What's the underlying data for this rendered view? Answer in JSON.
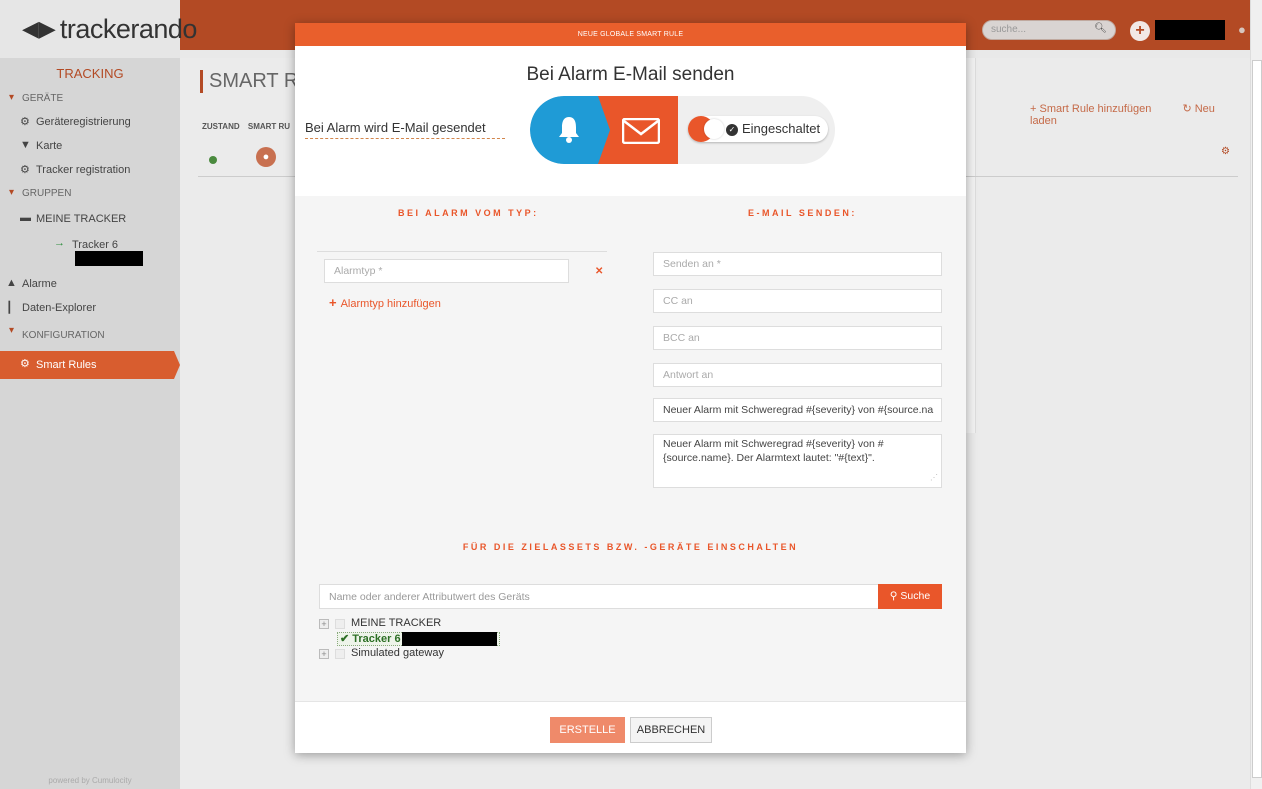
{
  "app": {
    "logo_glyph": "◀▶",
    "logo_text": "trackerando",
    "search_placeholder": "suche...",
    "accent_color": "#e9562a"
  },
  "sidebar": {
    "title": "TRACKING",
    "sections": [
      {
        "label": "GERÄTE"
      },
      {
        "label": "GRUPPEN"
      },
      {
        "label": "KONFIGURATION"
      }
    ],
    "items": {
      "registration": "Geräteregistrierung",
      "map": "Karte",
      "tracker_registration": "Tracker registration",
      "my_trackers": "MEINE TRACKER",
      "tracker": "Tracker 6",
      "alarms": "Alarme",
      "data_explorer": "Daten-Explorer",
      "smart_rules": "Smart Rules"
    },
    "footer": "powered by Cumulocity"
  },
  "background": {
    "page_title": "SMART R",
    "add_rule": "Smart Rule hinzufügen",
    "reload": "Neu laden",
    "col_state": "ZUSTAND",
    "col_rule": "SMART RU"
  },
  "modal": {
    "header": "NEUE GLOBALE SMART RULE",
    "title": "Bei Alarm E-Mail senden",
    "description": "Bei Alarm wird E-Mail gesendet",
    "toggle_label": "Eingeschaltet",
    "alarm_heading": "BEI ALARM VOM TYP:",
    "email_heading": "E-MAIL SENDEN:",
    "alarm_type_placeholder": "Alarmtyp *",
    "add_alarm_type": "Alarmtyp hinzufügen",
    "send_to_placeholder": "Senden an *",
    "cc_placeholder": "CC an",
    "bcc_placeholder": "BCC an",
    "reply_placeholder": "Antwort an",
    "subject_value": "Neuer Alarm mit Schweregrad #{severity} von #{source.na",
    "body_value": "Neuer Alarm mit Schweregrad #{severity} von #{source.name}. Der Alarmtext lautet: \"#{text}\".",
    "assets_heading": "FÜR DIE ZIELASSETS BZW. -GERÄTE EINSCHALTEN",
    "asset_search_placeholder": "Name oder anderer Attributwert des Geräts",
    "search_button": "Suche",
    "tree": [
      {
        "label": "MEINE TRACKER",
        "selected": false
      },
      {
        "label": "Tracker 6",
        "selected": true
      },
      {
        "label": "Simulated gateway",
        "selected": false
      }
    ],
    "create_button": "ERSTELLE",
    "cancel_button": "ABBRECHEN"
  }
}
